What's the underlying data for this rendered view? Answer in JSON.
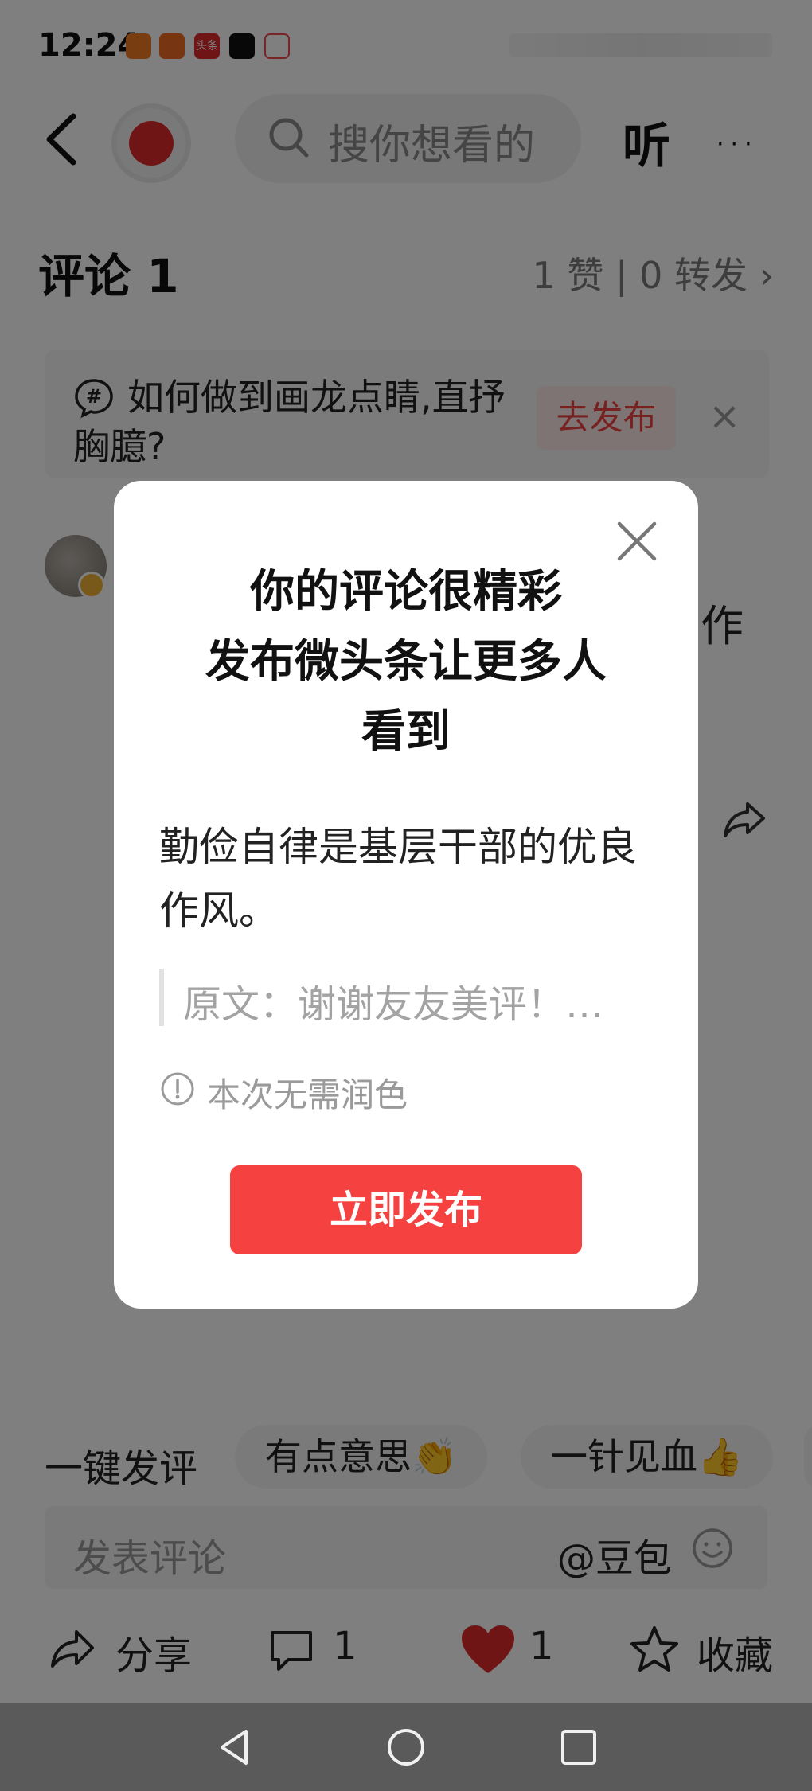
{
  "status_bar": {
    "time": "12:24",
    "app_icons": [
      {
        "name": "ganji-icon",
        "color": "#f07b23"
      },
      {
        "name": "app-icon-orange",
        "color": "#f06a22"
      },
      {
        "name": "toutiao-icon",
        "color": "#e02b2b",
        "text": "头条"
      },
      {
        "name": "douyin-icon",
        "color": "#111111"
      },
      {
        "name": "mail-icon",
        "color": "#ee4b4b"
      }
    ]
  },
  "header": {
    "search_placeholder": "搜你想看的",
    "listen_label": "听",
    "more_label": "···"
  },
  "comments": {
    "title": "评论 1",
    "stats": "1 赞 | 0 转发 ›"
  },
  "topic": {
    "text": "如何做到画龙点睛,直抒胸臆?",
    "publish_button": "去发布",
    "close": "×"
  },
  "background_comment": {
    "peek_text": "作"
  },
  "quick_reply": {
    "label": "一键发评",
    "pills": [
      "有点意思👏",
      "一针见血👍"
    ]
  },
  "comment_input": {
    "placeholder": "发表评论",
    "at_label": "@豆包"
  },
  "actions": {
    "share": "分享",
    "comment_count": "1",
    "like_count": "1",
    "favorite": "收藏"
  },
  "dialog": {
    "title_line1": "你的评论很精彩",
    "title_line2": "发布微头条让更多人看到",
    "body": "勤俭自律是基层干部的优良作风。",
    "quote": "原文：谢谢友友美评！…",
    "note": "本次无需润色",
    "publish_button": "立即发布"
  },
  "colors": {
    "accent_red": "#f5413f",
    "topic_button_bg": "#ffe9e9",
    "heart_red": "#e02b2b"
  }
}
